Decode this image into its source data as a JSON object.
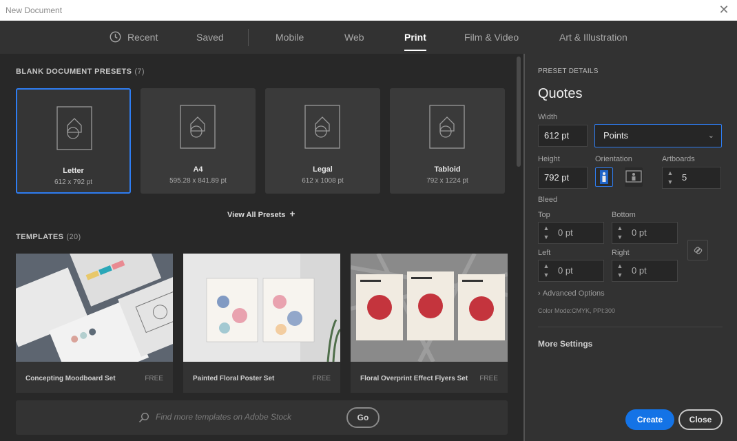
{
  "window": {
    "title": "New Document"
  },
  "tabs": [
    {
      "label": "Recent"
    },
    {
      "label": "Saved"
    },
    {
      "label": "Mobile"
    },
    {
      "label": "Web"
    },
    {
      "label": "Print"
    },
    {
      "label": "Film & Video"
    },
    {
      "label": "Art & Illustration"
    }
  ],
  "active_tab": "Print",
  "presets_section": {
    "title": "BLANK DOCUMENT PRESETS",
    "count": "(7)"
  },
  "presets": [
    {
      "name": "Letter",
      "size": "612 x 792 pt"
    },
    {
      "name": "A4",
      "size": "595.28 x 841.89 pt"
    },
    {
      "name": "Legal",
      "size": "612 x 1008 pt"
    },
    {
      "name": "Tabloid",
      "size": "792 x 1224 pt"
    }
  ],
  "view_all": "View All Presets",
  "templates_section": {
    "title": "TEMPLATES",
    "count": "(20)"
  },
  "templates": [
    {
      "name": "Concepting Moodboard Set",
      "price": "FREE"
    },
    {
      "name": "Painted Floral Poster Set",
      "price": "FREE"
    },
    {
      "name": "Floral Overprint Effect Flyers Set",
      "price": "FREE"
    }
  ],
  "stock": {
    "placeholder": "Find more templates on Adobe Stock",
    "go_label": "Go"
  },
  "details": {
    "header": "PRESET DETAILS",
    "name": "Quotes",
    "width_label": "Width",
    "width": "612 pt",
    "units": "Points",
    "height_label": "Height",
    "height": "792 pt",
    "orientation_label": "Orientation",
    "artboards_label": "Artboards",
    "artboards": "5",
    "bleed_label": "Bleed",
    "bleed_top_label": "Top",
    "bleed_top": "0 pt",
    "bleed_bottom_label": "Bottom",
    "bleed_bottom": "0 pt",
    "bleed_left_label": "Left",
    "bleed_left": "0 pt",
    "bleed_right_label": "Right",
    "bleed_right": "0 pt",
    "advanced": "Advanced Options",
    "color_mode": "Color Mode:CMYK, PPI:300",
    "more_settings": "More Settings",
    "create": "Create",
    "close": "Close"
  },
  "colors": {
    "accent": "#1473e6",
    "selection": "#2e7df2"
  }
}
